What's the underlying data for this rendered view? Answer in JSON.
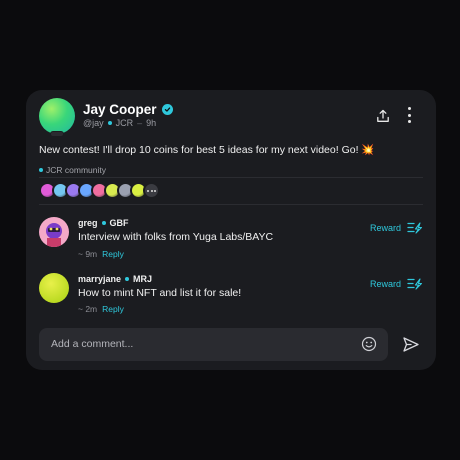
{
  "post": {
    "author_name": "Jay Cooper",
    "handle": "@jay",
    "community_tag": "JCR",
    "time": "9h",
    "text": "New contest! I'll drop 10 coins for best 5 ideas for my next video! Go! 💥",
    "community_label": "JCR community",
    "member_avatar_colors": [
      "#e05bd8",
      "#74c6f0",
      "#9a7af0",
      "#6aa7ff",
      "#f06ea0",
      "#d8ea50",
      "#9aa0b0",
      "#d9ef42"
    ]
  },
  "comments": [
    {
      "handle": "greg",
      "tag": "GBF",
      "text": "Interview with folks from Yuga Labs/BAYC",
      "time": "~ 9m",
      "reply_label": "Reply",
      "reward_label": "Reward"
    },
    {
      "handle": "marryjane",
      "tag": "MRJ",
      "text": "How to mint NFT and list it for sale!",
      "time": "~ 2m",
      "reply_label": "Reply",
      "reward_label": "Reward"
    }
  ],
  "composer": {
    "placeholder": "Add a comment..."
  },
  "icons": {
    "share": "share-icon",
    "more": "more-vertical-icon",
    "emoji": "emoji-icon",
    "send": "send-icon",
    "reward": "reward-icon",
    "verified": "verified-icon"
  },
  "colors": {
    "accent": "#2fc8dc",
    "card": "#1b1c20",
    "background": "#0b0b0d"
  }
}
